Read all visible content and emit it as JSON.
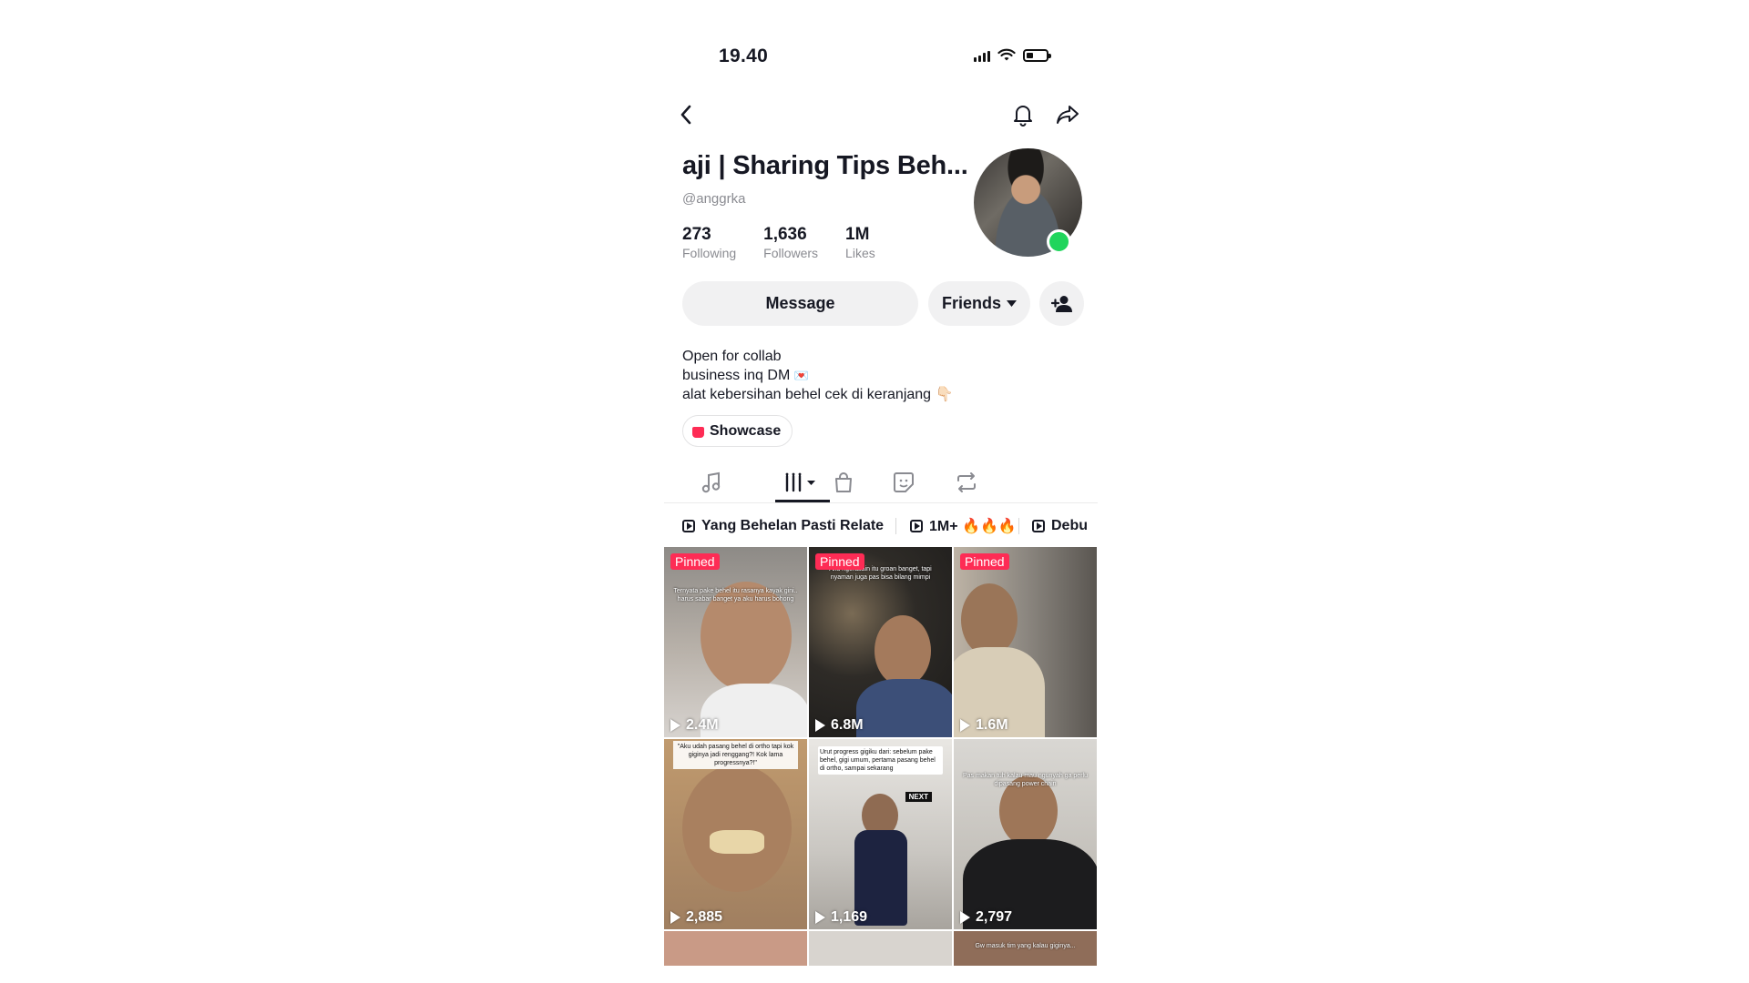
{
  "status_bar": {
    "time": "19.40",
    "battery_level": 0.35
  },
  "header": {
    "display_name": "aji | Sharing Tips Beh...",
    "handle": "@anggrka",
    "online_color": "#20d55c"
  },
  "stats": [
    {
      "value": "273",
      "label": "Following"
    },
    {
      "value": "1,636",
      "label": "Followers"
    },
    {
      "value": "1M",
      "label": "Likes"
    }
  ],
  "actions": {
    "message": "Message",
    "friends": "Friends"
  },
  "bio": {
    "line1": "Open for collab",
    "line2": "business inq DM",
    "line2_emoji": "💌",
    "line3": "alat kebersihan behel cek di keranjang",
    "line3_emoji": "👇🏻"
  },
  "showcase": "Showcase",
  "tabs": [
    "music-icon",
    "videos-icon",
    "shop-bag-icon",
    "sticker-icon",
    "repost-icon"
  ],
  "playlists": [
    "Yang Behelan Pasti Relate",
    "1M+ 🔥🔥🔥",
    "Debu"
  ],
  "videos": [
    {
      "pinned": "Pinned",
      "views": "2.4M",
      "caption": "Ternyata pake behel itu rasanya kayak gini.. harus sabar banget ya aku harus bohong"
    },
    {
      "pinned": "Pinned",
      "views": "6.8M",
      "caption": "Aku ngerasain itu groan banget, tapi nyaman juga pas bisa bilang mimpi"
    },
    {
      "pinned": "Pinned",
      "views": "1.6M",
      "caption": ""
    },
    {
      "pinned": "",
      "views": "2,885",
      "caption": "\"Aku udah pasang behel di ortho tapi kok giginya jadi renggang?! Kok lama progressnya?!\""
    },
    {
      "pinned": "",
      "views": "1,169",
      "caption": "Urut progress gigiku dari: sebelum pake behel, gigi umum, pertama pasang behel di ortho, sampai sekarang",
      "badge": "NEXT"
    },
    {
      "pinned": "",
      "views": "2,797",
      "caption": "Pas makan tuh kalau mau ngunyah ga perlu dipasang power chain"
    }
  ],
  "bottom_row_caption": "Gw masuk tim yang kalau giginya..."
}
